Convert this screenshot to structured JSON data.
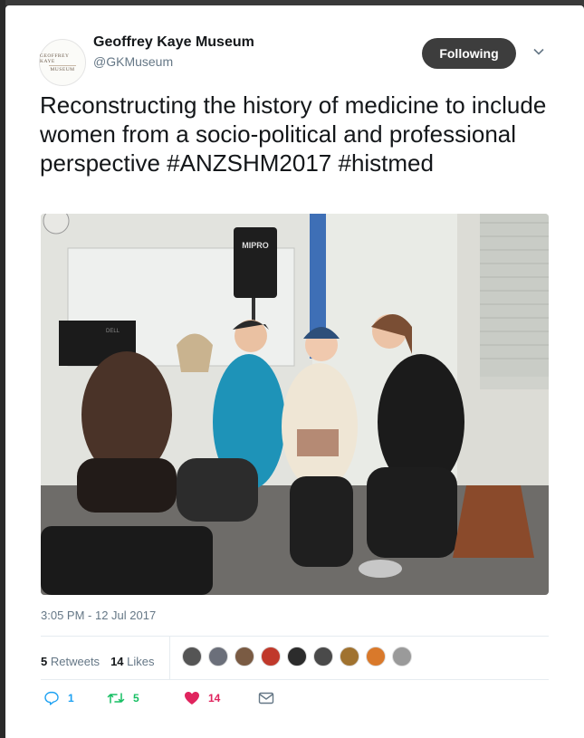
{
  "account": {
    "name": "Geoffrey Kaye Museum",
    "handle": "@GKMuseum",
    "avatar_text_line1": "GEOFFREY KAYE",
    "avatar_text_line2": "MUSEUM"
  },
  "follow_button": {
    "label": "Following"
  },
  "tweet": {
    "text": "Reconstructing the history of medicine to include women from a socio-political and professional perspective #ANZSHM2017 #histmed",
    "timestamp": "3:05 PM - 12 Jul 2017"
  },
  "photo": {
    "speaker_brand": "MIPRO",
    "monitor_brand": "DELL"
  },
  "stats": {
    "retweets_count": "5",
    "retweets_label": "Retweets",
    "likes_count": "14",
    "likes_label": "Likes"
  },
  "likers": [
    {
      "icon": "avatar",
      "color": "#555555"
    },
    {
      "icon": "avatar",
      "color": "#6b6f7a"
    },
    {
      "icon": "avatar",
      "color": "#7a5b43"
    },
    {
      "icon": "avatar",
      "color": "#c0392b"
    },
    {
      "icon": "avatar",
      "color": "#2c2c2c"
    },
    {
      "icon": "avatar",
      "color": "#4a4a4a"
    },
    {
      "icon": "avatar",
      "color": "#a0722f"
    },
    {
      "icon": "avatar",
      "color": "#d9792b"
    },
    {
      "icon": "avatar",
      "color": "#9a9a9a"
    }
  ],
  "actions": {
    "reply_count": "1",
    "retweet_count": "5",
    "like_count": "14"
  },
  "colors": {
    "reply": "#1da1f2",
    "retweet": "#17bf63",
    "like": "#e0245e",
    "message": "#657786",
    "follow_bg": "#3d3d3d"
  }
}
